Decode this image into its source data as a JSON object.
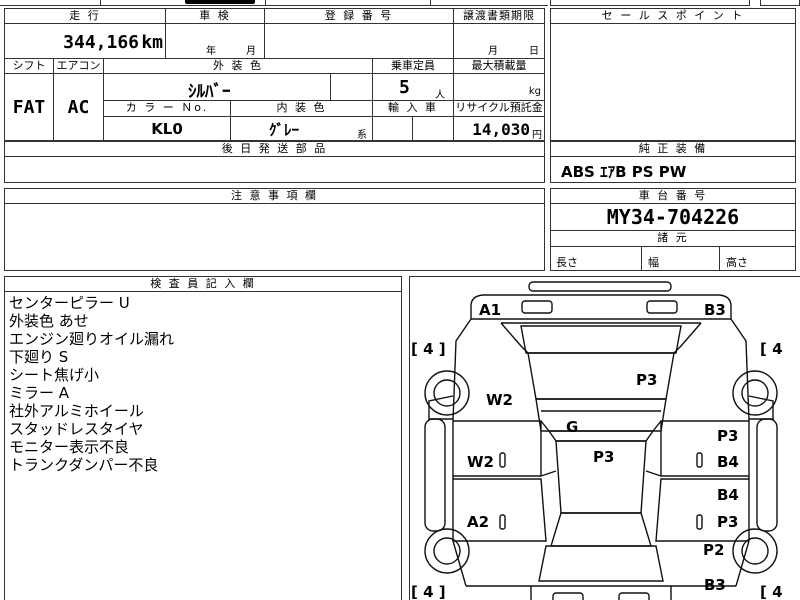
{
  "header": {
    "mileage_label": "走 行",
    "mileage_value": "344,166",
    "mileage_unit": "km",
    "inspection_label": "車 検",
    "inspection_year": "年",
    "inspection_month": "月",
    "reg_number_label": "登 録 番 号",
    "transfer_label": "譲渡書類期限",
    "transfer_month": "月",
    "transfer_day": "日",
    "sales_point_label": "セ ー ル ス ポ イ ン ト"
  },
  "row2": {
    "shift_label": "シフト",
    "aircon_label": "エアコン",
    "exterior_color_label": "外 装 色",
    "capacity_label": "乗車定員",
    "max_load_label": "最大積載量",
    "shift_value": "FAT",
    "aircon_value": "AC",
    "exterior_color_value": "ｼﾙﾊﾞｰ",
    "capacity_value": "5",
    "capacity_unit": "人",
    "load_unit": "kg",
    "color_no_label": "カ ラ ー Ｎo.",
    "interior_color_label": "内 装 色",
    "import_label": "輸 入 車",
    "recycle_label": "リサイクル預託金",
    "color_no_value": "KL0",
    "interior_color_value": "ｸﾞﾚｰ",
    "interior_suffix": "系",
    "recycle_value": "14,030",
    "recycle_unit": "円",
    "deferred_parts_label": "後 日 発 送 部 品"
  },
  "standard_equipment": {
    "label": "純 正 装 備",
    "value": "ABS ｴｱB PS PW"
  },
  "notes_section": {
    "label": "注 意 事 項 欄"
  },
  "chassis": {
    "label": "車 台 番 号",
    "value": "MY34-704226",
    "specs_label": "諸 元",
    "length_label": "長さ",
    "width_label": "幅",
    "height_label": "高さ"
  },
  "inspector": {
    "label": "検 査 員 記 入 欄",
    "notes": [
      "センターピラー U",
      "外装色 あせ",
      "エンジン廻りオイル漏れ",
      "下廻り S",
      "シート焦げ小",
      "ミラー A",
      "社外アルミホイール",
      "スタッドレスタイヤ",
      "モニター表示不良",
      "トランクダンパー不良"
    ]
  },
  "diagram": {
    "marks": {
      "a1": "A1",
      "b3_top": "B3",
      "w2_left": "W2",
      "p3_roof": "P3",
      "g": "G",
      "w2_door": "W2",
      "p3_center": "P3",
      "p3_right_door": "P3",
      "b4_right_door": "B4",
      "b4_rear_door": "B4",
      "a2": "A2",
      "p3_rear_door": "P3",
      "p2": "P2",
      "b3_bottom": "B3"
    },
    "tire_brackets": {
      "front_left": "[ 4 ]",
      "front_right": "[ 4",
      "rear_left": "[ 4 ]",
      "rear_right": "[ 4"
    }
  }
}
